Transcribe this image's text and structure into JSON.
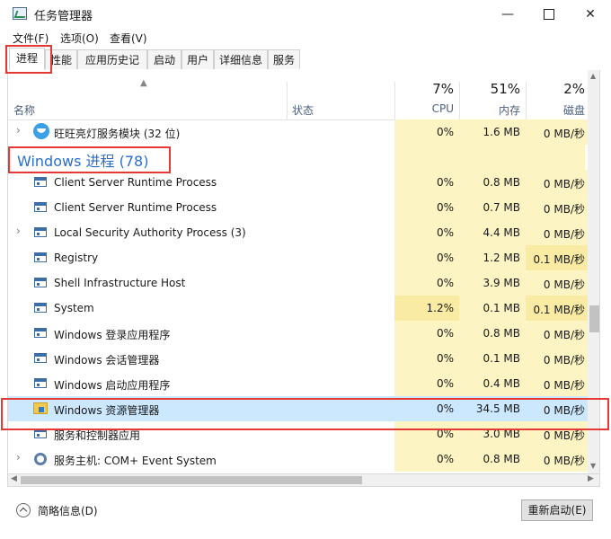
{
  "window": {
    "title": "任务管理器",
    "min_glyph": "—",
    "close_glyph": "✕"
  },
  "menu": [
    "文件(F)",
    "选项(O)",
    "查看(V)"
  ],
  "tabs": [
    "进程",
    "性能",
    "应用历史记录",
    "启动",
    "用户",
    "详细信息",
    "服务"
  ],
  "columns": {
    "name": "名称",
    "status": "状态",
    "cpu": {
      "pct": "7%",
      "label": "CPU"
    },
    "memory": {
      "pct": "51%",
      "label": "内存"
    },
    "disk": {
      "pct": "2%",
      "label": "磁盘"
    }
  },
  "rows": [
    {
      "name": "旺旺亮灯服务模块 (32 位)",
      "cpu": "0%",
      "memory": "1.6 MB",
      "disk": "0 MB/秒",
      "expandable": true,
      "icon": "wangwang-icon"
    },
    {
      "group": "Windows 进程 (78)"
    },
    {
      "name": "Client Server Runtime Process",
      "cpu": "0%",
      "memory": "0.8 MB",
      "disk": "0 MB/秒",
      "icon": "process-icon"
    },
    {
      "name": "Client Server Runtime Process",
      "cpu": "0%",
      "memory": "0.7 MB",
      "disk": "0 MB/秒",
      "icon": "process-icon"
    },
    {
      "name": "Local Security Authority Process (3)",
      "cpu": "0%",
      "memory": "4.4 MB",
      "disk": "0 MB/秒",
      "expandable": true,
      "icon": "process-icon"
    },
    {
      "name": "Registry",
      "cpu": "0%",
      "memory": "1.2 MB",
      "disk": "0.1 MB/秒",
      "icon": "process-icon"
    },
    {
      "name": "Shell Infrastructure Host",
      "cpu": "0%",
      "memory": "3.9 MB",
      "disk": "0 MB/秒",
      "icon": "process-icon"
    },
    {
      "name": "System",
      "cpu": "1.2%",
      "memory": "0.1 MB",
      "disk": "0.1 MB/秒",
      "icon": "process-icon"
    },
    {
      "name": "Windows 登录应用程序",
      "cpu": "0%",
      "memory": "0.8 MB",
      "disk": "0 MB/秒",
      "icon": "process-icon"
    },
    {
      "name": "Windows 会话管理器",
      "cpu": "0%",
      "memory": "0.1 MB",
      "disk": "0 MB/秒",
      "icon": "process-icon"
    },
    {
      "name": "Windows 启动应用程序",
      "cpu": "0%",
      "memory": "0.4 MB",
      "disk": "0 MB/秒",
      "icon": "process-icon"
    },
    {
      "name": "Windows 资源管理器",
      "cpu": "0%",
      "memory": "34.5 MB",
      "disk": "0 MB/秒",
      "selected": true,
      "icon": "explorer-icon"
    },
    {
      "name": "服务和控制器应用",
      "cpu": "0%",
      "memory": "3.0 MB",
      "disk": "0 MB/秒",
      "icon": "process-icon"
    },
    {
      "name": "服务主机: COM+ Event System",
      "cpu": "0%",
      "memory": "0.8 MB",
      "disk": "0 MB/秒",
      "expandable": true,
      "icon": "gear-icon"
    }
  ],
  "footer": {
    "fewer_details": "简略信息(D)",
    "end_task": "重新启动(E)"
  },
  "colors": {
    "heat_light": "#fdf4c4",
    "heat_strong": "#f9eba4",
    "selected": "#cce8ff",
    "annotation": "#e53935",
    "group_title": "#2a6fc9"
  }
}
